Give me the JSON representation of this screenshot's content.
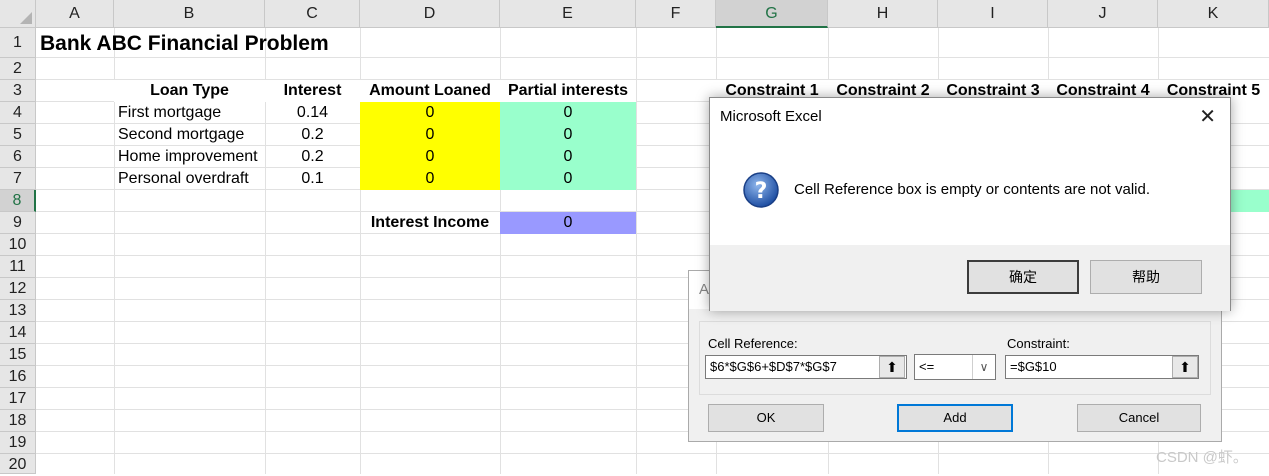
{
  "spreadsheet": {
    "columns": [
      "A",
      "B",
      "C",
      "D",
      "E",
      "F",
      "G",
      "H",
      "I",
      "J",
      "K"
    ],
    "rows": [
      "1",
      "2",
      "3",
      "4",
      "5",
      "6",
      "7",
      "8",
      "9",
      "10",
      "11",
      "12",
      "13",
      "14",
      "15",
      "16",
      "17",
      "18",
      "19",
      "20"
    ],
    "title": "Bank ABC Financial Problem",
    "headers": {
      "loan_type": "Loan Type",
      "interest": "Interest",
      "amount_loaned": "Amount Loaned",
      "partial_interests": "Partial interests"
    },
    "loans": [
      {
        "type": "First mortgage",
        "interest": "0.14",
        "amount": "0",
        "partial": "0"
      },
      {
        "type": "Second mortgage",
        "interest": "0.2",
        "amount": "0",
        "partial": "0"
      },
      {
        "type": "Home improvement",
        "interest": "0.2",
        "amount": "0",
        "partial": "0"
      },
      {
        "type": "Personal overdraft",
        "interest": "0.1",
        "amount": "0",
        "partial": "0"
      }
    ],
    "interest_income_label": "Interest Income",
    "interest_income_value": "0",
    "constraints": [
      "Constraint 1",
      "Constraint 2",
      "Constraint 3",
      "Constraint 4",
      "Constraint 5"
    ],
    "colors": {
      "yellow": "#ffff00",
      "mint": "#99ffcc",
      "blue": "#9999ff",
      "selected_accent": "#217346"
    }
  },
  "add_constraint_dialog": {
    "title_fragment": "A",
    "cell_reference_label": "Cell Reference:",
    "cell_reference_value": "$6*$G$6+$D$7*$G$7",
    "operator": "<=",
    "constraint_label": "Constraint:",
    "constraint_value": "=$G$10",
    "ok_label": "OK",
    "add_label": "Add",
    "cancel_label": "Cancel"
  },
  "message_box": {
    "title": "Microsoft Excel",
    "message": "Cell Reference box is empty or contents are not valid.",
    "ok_label": "确定",
    "help_label": "帮助",
    "icon": "question-icon"
  },
  "watermark": "CSDN @虾。"
}
